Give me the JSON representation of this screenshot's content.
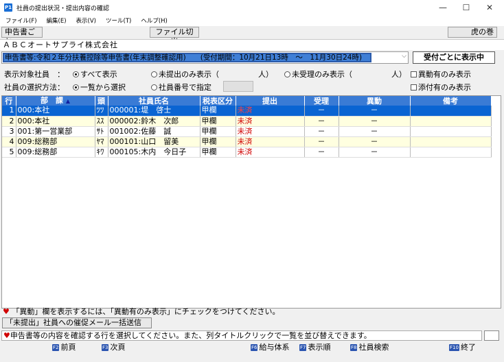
{
  "window": {
    "icon_label": "P1",
    "title": "社員の提出状況・提出内容の確認",
    "minimize": "—",
    "maximize": "☐",
    "close": "✕"
  },
  "menu": [
    "ファイル(F)",
    "編集(E)",
    "表示(V)",
    "ツール(T)",
    "ヘルプ(H)"
  ],
  "toolbar": {
    "by_document": "申告書ごと",
    "file_switch": "ファイル切出",
    "tiger_scroll": "虎の巻"
  },
  "company_name": "ＡＢＣオートサプライ株式会社",
  "document": {
    "selected": "申告書等:令和２年分扶養控除等申告書(年末調整確認用)　　(受付期間：10月21日13時　～　11月30日24時)",
    "show_by_receipt": "受付ごとに表示中"
  },
  "filters": {
    "target_label": "表示対象社員　：",
    "opt_all": "すべて表示",
    "opt_unsubmitted": "未提出のみ表示（",
    "unit1": "人）",
    "opt_unreceived": "未受理のみ表示（",
    "unit2": "人）",
    "chk_changes": "異動有のみ表示",
    "method_label": "社員の選択方法：",
    "opt_list": "一覧から選択",
    "opt_number": "社員番号で指定",
    "chk_attach": "添付有のみ表示"
  },
  "table": {
    "headers": [
      "行",
      "部　課",
      "頭",
      "社員氏名",
      "税表区分",
      "提出",
      "受理",
      "異動",
      "備考"
    ],
    "sort_indicator": "▲",
    "rows": [
      {
        "no": "1",
        "dept": "000:本社",
        "kana": "ﾂﾂ",
        "name": "000001:堤　啓士",
        "tax": "甲欄",
        "submit": "未済",
        "accept": "－",
        "change": "－",
        "note": ""
      },
      {
        "no": "2",
        "dept": "000:本社",
        "kana": "ｽｽ",
        "name": "000002:鈴木　次郎",
        "tax": "甲欄",
        "submit": "未済",
        "accept": "－",
        "change": "－",
        "note": ""
      },
      {
        "no": "3",
        "dept": "001:第一営業部",
        "kana": "ｻﾄ",
        "name": "001002:佐藤　誠",
        "tax": "甲欄",
        "submit": "未済",
        "accept": "－",
        "change": "－",
        "note": ""
      },
      {
        "no": "4",
        "dept": "009:総務部",
        "kana": "ﾔﾏ",
        "name": "000101:山口　留美",
        "tax": "甲欄",
        "submit": "未済",
        "accept": "－",
        "change": "－",
        "note": ""
      },
      {
        "no": "5",
        "dept": "009:総務部",
        "kana": "ｷﾜ",
        "name": "000105:木内　今日子",
        "tax": "甲欄",
        "submit": "未済",
        "accept": "－",
        "change": "－",
        "note": ""
      }
    ]
  },
  "notice": "「異動」欄を表示するには、「異動有のみ表示」にチェックをつけてください。",
  "send_button": "「未提出」社員への催促メール一括送信",
  "status": "申告書等の内容を確認する行を選択してください。また、列タイトルクリックで一覧を並び替えできます。",
  "fkeys": [
    {
      "key": "F2",
      "label": "前頁"
    },
    {
      "key": "F3",
      "label": "次頁"
    },
    {
      "key": "F6",
      "label": "給与体系"
    },
    {
      "key": "F7",
      "label": "表示順"
    },
    {
      "key": "F8",
      "label": "社員検索"
    },
    {
      "key": "F10",
      "label": "終了"
    }
  ],
  "colors": {
    "header_bg": "#3a7bd5",
    "selected_row": "#0a64d2",
    "alt_row": "#ffffe0",
    "unsubmitted_text": "#d00000"
  }
}
